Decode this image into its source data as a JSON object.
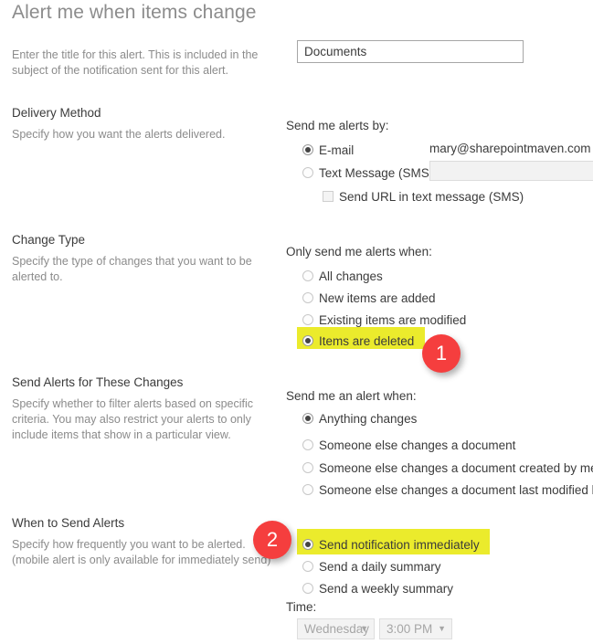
{
  "page_title": "Alert me when items change",
  "colors": {
    "highlight": "#ebeb2c",
    "badge": "#f53e3e",
    "heading": "#8c8c8c",
    "label": "#3b3b3b",
    "description": "#8b8b8b"
  },
  "alert_title": {
    "description": "Enter the title for this alert. This is included in the subject of the notification sent for this alert.",
    "value": "Documents"
  },
  "delivery_method": {
    "heading": "Delivery Method",
    "description": "Specify how you want the alerts delivered.",
    "group_label": "Send me alerts by:",
    "options": [
      {
        "label": "E-mail",
        "selected": true
      },
      {
        "label": "Text Message (SMS)",
        "selected": false
      }
    ],
    "email_value": "mary@sharepointmaven.com",
    "sms_value": "",
    "send_url_checkbox": {
      "label": "Send URL in text message (SMS)",
      "checked": false
    }
  },
  "change_type": {
    "heading": "Change Type",
    "description": "Specify the type of changes that you want to be alerted to.",
    "group_label": "Only send me alerts when:",
    "options": [
      {
        "label": "All changes",
        "selected": false
      },
      {
        "label": "New items are added",
        "selected": false
      },
      {
        "label": "Existing items are modified",
        "selected": false
      },
      {
        "label": "Items are deleted",
        "selected": true,
        "highlighted": true
      }
    ]
  },
  "send_alerts_for_changes": {
    "heading": "Send Alerts for These Changes",
    "description": "Specify whether to filter alerts based on specific criteria. You may also restrict your alerts to only include items that show in a particular view.",
    "group_label": "Send me an alert when:",
    "options": [
      {
        "label": "Anything changes",
        "selected": true
      },
      {
        "label": "Someone else changes a document",
        "selected": false
      },
      {
        "label": "Someone else changes a document created by me",
        "selected": false
      },
      {
        "label": "Someone else changes a document last modified by",
        "selected": false
      }
    ]
  },
  "when_to_send": {
    "heading": "When to Send Alerts",
    "description_line1": "Specify how frequently you want to be alerted.",
    "description_line2": "(mobile alert is only available for immediately send)",
    "options": [
      {
        "label": "Send notification immediately",
        "selected": true,
        "highlighted": true
      },
      {
        "label": "Send a daily summary",
        "selected": false
      },
      {
        "label": "Send a weekly summary",
        "selected": false
      }
    ],
    "time_label": "Time:",
    "day_dropdown": {
      "value": "Wednesday",
      "disabled": true
    },
    "time_dropdown": {
      "value": "3:00 PM",
      "disabled": true
    }
  },
  "callouts": [
    {
      "number": "1"
    },
    {
      "number": "2"
    }
  ]
}
